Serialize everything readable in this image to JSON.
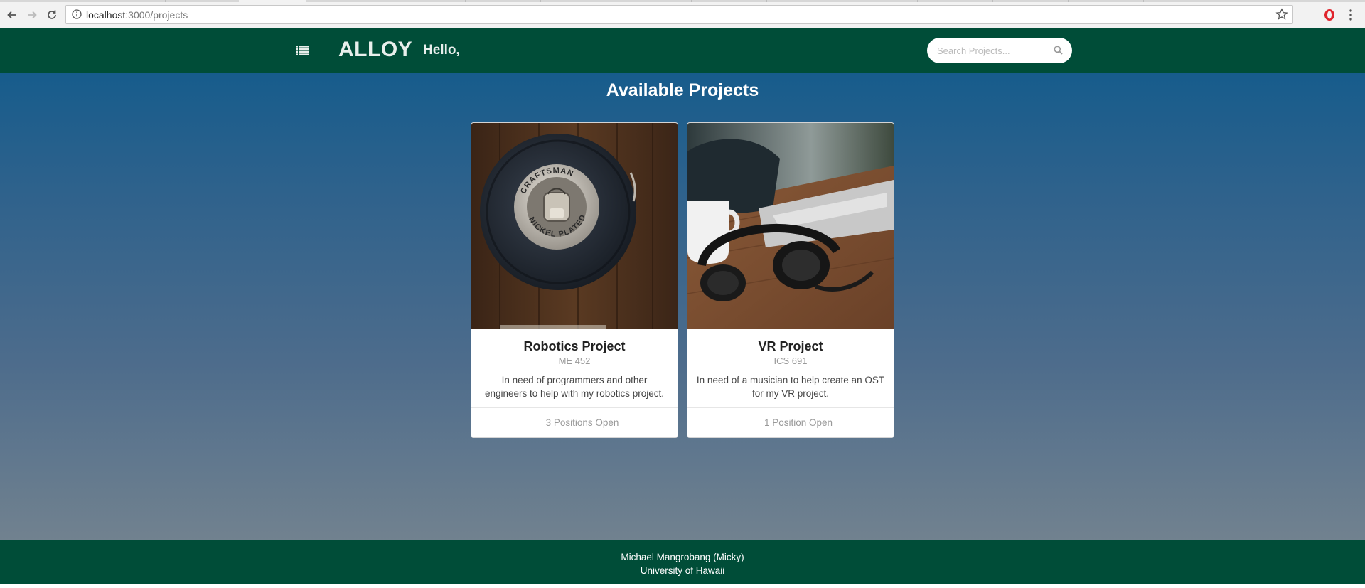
{
  "browser": {
    "url_host": "localhost",
    "url_path": ":3000/projects"
  },
  "navbar": {
    "brand": "ALLOY",
    "greeting": "Hello,",
    "search_placeholder": "Search Projects..."
  },
  "page": {
    "heading": "Available Projects"
  },
  "projects": [
    {
      "title": "Robotics Project",
      "course": "ME 452",
      "description": "In need of programmers and other engineers to help with my robotics project.",
      "positions": "3 Positions Open",
      "photo_text_top": "CRAFTSMAN",
      "photo_text_bottom": "NICKEL PLATED"
    },
    {
      "title": "VR Project",
      "course": "ICS 691",
      "description": "In need of a musician to help create an OST for my VR project.",
      "positions": "1 Position Open"
    }
  ],
  "footer": {
    "name": "Michael Mangrobang (Micky)",
    "school": "University of Hawaii"
  },
  "colors": {
    "navbar_green": "#004d38",
    "background_top": "#0e5a8c",
    "background_bottom": "#7a8790"
  }
}
